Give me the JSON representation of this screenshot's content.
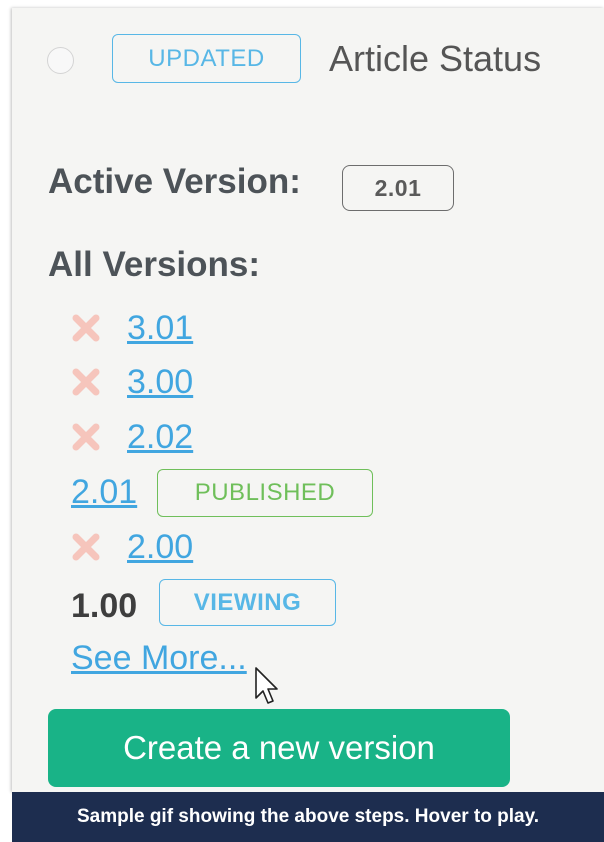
{
  "header": {
    "status_badge": "UPDATED",
    "title": "Article Status"
  },
  "active_version": {
    "label": "Active Version:",
    "value": "2.01"
  },
  "all_versions": {
    "label": "All Versions:",
    "items": [
      {
        "version": "3.01",
        "icon": "delete-x-icon"
      },
      {
        "version": "3.00",
        "icon": "delete-x-icon"
      },
      {
        "version": "2.02",
        "icon": "delete-x-icon"
      },
      {
        "version": "2.01",
        "badge": "PUBLISHED"
      },
      {
        "version": "2.00",
        "icon": "delete-x-icon"
      },
      {
        "version": "1.00",
        "badge": "VIEWING"
      }
    ],
    "see_more": "See More..."
  },
  "create_button": "Create a new version",
  "caption": "Sample gif showing the above steps. Hover to play.",
  "colors": {
    "panel_bg": "#f5f5f3",
    "link": "#41a6e0",
    "updated_badge": "#58b7e6",
    "published_badge": "#6fbf5a",
    "delete_icon": "#f6c5bc",
    "button_bg": "#19b387",
    "caption_bg": "#1d2d4f"
  }
}
